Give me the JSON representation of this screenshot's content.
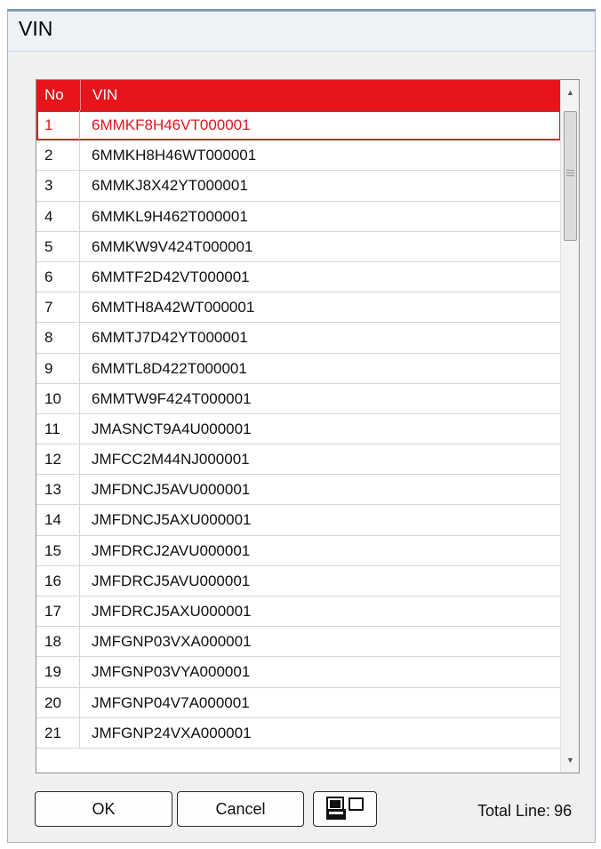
{
  "window": {
    "title": "VIN"
  },
  "table": {
    "columns": [
      "No",
      "VIN"
    ],
    "selected_index": 0,
    "rows": [
      {
        "no": "1",
        "vin": "6MMKF8H46VT000001"
      },
      {
        "no": "2",
        "vin": "6MMKH8H46WT000001"
      },
      {
        "no": "3",
        "vin": "6MMKJ8X42YT000001"
      },
      {
        "no": "4",
        "vin": "6MMKL9H462T000001"
      },
      {
        "no": "5",
        "vin": "6MMKW9V424T000001"
      },
      {
        "no": "6",
        "vin": "6MMTF2D42VT000001"
      },
      {
        "no": "7",
        "vin": "6MMTH8A42WT000001"
      },
      {
        "no": "8",
        "vin": "6MMTJ7D42YT000001"
      },
      {
        "no": "9",
        "vin": "6MMTL8D422T000001"
      },
      {
        "no": "10",
        "vin": "6MMTW9F424T000001"
      },
      {
        "no": "11",
        "vin": "JMASNCT9A4U000001"
      },
      {
        "no": "12",
        "vin": "JMFCC2M44NJ000001"
      },
      {
        "no": "13",
        "vin": "JMFDNCJ5AVU000001"
      },
      {
        "no": "14",
        "vin": "JMFDNCJ5AXU000001"
      },
      {
        "no": "15",
        "vin": "JMFDRCJ2AVU000001"
      },
      {
        "no": "16",
        "vin": "JMFDRCJ5AVU000001"
      },
      {
        "no": "17",
        "vin": "JMFDRCJ5AXU000001"
      },
      {
        "no": "18",
        "vin": "JMFGNP03VXA000001"
      },
      {
        "no": "19",
        "vin": "JMFGNP03VYA000001"
      },
      {
        "no": "20",
        "vin": "JMFGNP04V7A000001"
      },
      {
        "no": "21",
        "vin": "JMFGNP24VXA000001"
      }
    ]
  },
  "buttons": {
    "ok": "OK",
    "cancel": "Cancel",
    "print_icon": "print-icon"
  },
  "footer": {
    "total_label": "Total Line:",
    "total_value": "96"
  },
  "colors": {
    "header_bg": "#e8141b",
    "selected_text": "#e8141b"
  }
}
